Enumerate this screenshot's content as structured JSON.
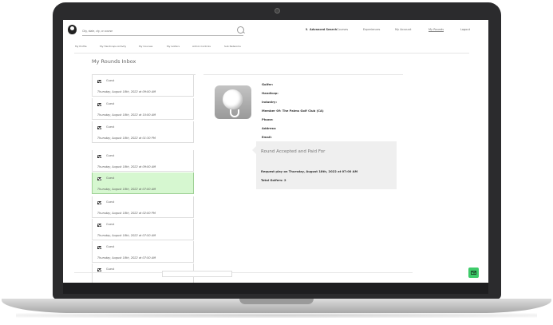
{
  "header": {
    "search_placeholder": "City, state, zip, or course",
    "advanced_search": "Advanced Search",
    "nav": [
      "Courses",
      "Experiences",
      "My Account",
      "My Rounds",
      "Logout"
    ]
  },
  "subnav": [
    "My Profile",
    "My Handicaps Activity",
    "My Courses",
    "My Golfers",
    "Admin Controls",
    "Sub Networks"
  ],
  "page_title": "My Rounds Inbox",
  "inbox": [
    {
      "from": "Guest",
      "date": "Thursday, August 18th, 2022 at 09:00 AM"
    },
    {
      "from": "Guest",
      "date": "Thursday, August 18th, 2022 at 10:00 AM"
    },
    {
      "from": "Guest",
      "date": "Thursday, August 18th, 2022 at 01:30 PM"
    },
    {
      "from": "Guest",
      "date": "Thursday, August 18th, 2022 at 09:00 AM"
    },
    {
      "from": "Guest",
      "date": "Thursday, August 18th, 2022 at 07:00 AM"
    },
    {
      "from": "Guest",
      "date": "Thursday, August 18th, 2022 at 02:00 PM"
    },
    {
      "from": "Guest",
      "date": "Thursday, August 18th, 2022 at 07:50 AM"
    },
    {
      "from": "Guest",
      "date": "Thursday, August 18th, 2022 at 07:50 AM"
    },
    {
      "from": "Guest",
      "date": ""
    }
  ],
  "selected_index": 4,
  "detail": {
    "golfer": "Golfer:",
    "handicap": "Handicap:",
    "industry": "Industry:",
    "member_of": "Member Of: The Palms Golf Club (CA)",
    "phone": "Phone:",
    "address": "Address:",
    "email": "Email:"
  },
  "panel": {
    "title": "Round Accepted and Paid For",
    "request": "Request play on Thursday, August 18th, 2022 at 07:00 AM",
    "total": "Total Golfers: 2"
  },
  "colors": {
    "selected_bg": "#d6f7d0",
    "fab_green": "#3ecb6a"
  }
}
